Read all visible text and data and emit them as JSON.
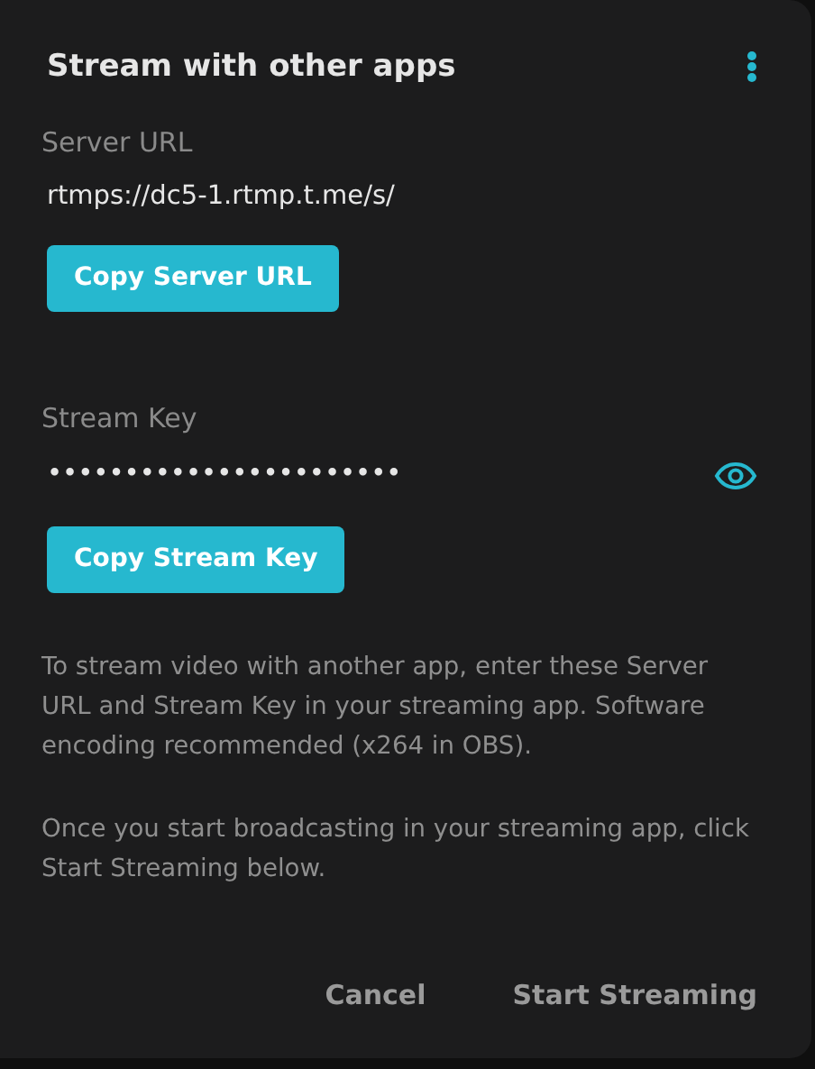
{
  "dialog": {
    "title": "Stream with other apps",
    "server_url": {
      "label": "Server URL",
      "value": "rtmps://dc5-1.rtmp.t.me/s/",
      "button": "Copy Server URL"
    },
    "stream_key": {
      "label": "Stream Key",
      "value": "•••••••••••••••••••••••",
      "button": "Copy Stream Key"
    },
    "paragraphs": [
      "To stream video with another app, enter these Server URL and Stream Key in your streaming app. Software encoding recommended (x264 in OBS).",
      "Once you start broadcasting in your streaming app, click Start Streaming below."
    ],
    "buttons": [
      "Cancel",
      "Start Streaming"
    ]
  }
}
